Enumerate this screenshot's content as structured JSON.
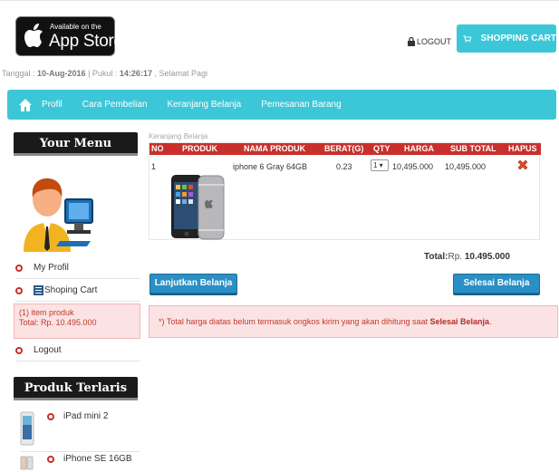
{
  "header": {
    "badge_small": "Available on the",
    "badge_large": "App Store",
    "logout": "LOGOUT",
    "cart_button": "SHOPPING CART",
    "icons": [
      "apple-icon",
      "lock-icon",
      "cart-icon"
    ]
  },
  "datebar": {
    "date_label": "Tanggal : ",
    "date_value": "10-Aug-2016",
    "time_label": " | Pukul : ",
    "time_value": "14:26:17",
    "greeting": " , Selamat Pagi"
  },
  "nav": {
    "home_icon": "home-icon",
    "items": [
      "Profil",
      "Cara Pembelian",
      "Keranjang Belanja",
      "Pemesanan Barang"
    ]
  },
  "sidebar": {
    "menu_title": "Your Menu",
    "items": [
      "My Profil",
      "Shoping Cart",
      "Logout"
    ],
    "cart_info_line1": "(1) item produk",
    "cart_info_line2": "Total: Rp. 10.495.000",
    "bestseller_title": "Produk Terlaris",
    "bestsellers": [
      "iPad mini 2",
      "iPhone SE 16GB"
    ]
  },
  "cart": {
    "caption": "Keranjang Belanja",
    "columns": [
      "NO",
      "PRODUK",
      "NAMA PRODUK",
      "BERAT(G)",
      "QTY",
      "HARGA",
      "SUB TOTAL",
      "HAPUS"
    ],
    "rows": [
      {
        "no": "1",
        "name": "iphone 6 Gray 64GB",
        "weight": "0.23",
        "qty": "1",
        "price": "10,495.000",
        "subtotal": "10,495.000"
      }
    ],
    "total_label": "Total:",
    "total_prefix": "Rp. ",
    "total_value": "10.495.000",
    "continue_button": "Lanjutkan Belanja",
    "finish_button": "Selesai Belanja",
    "notice_text": "*) Total harga diatas belum termasuk ongkos kirim yang akan dihitung saat ",
    "notice_bold": "Selesai Belanja",
    "notice_end": "."
  },
  "colors": {
    "accent": "#3cc7d8",
    "table_header": "#c9302c",
    "button": "#2a8fc4",
    "alert_bg": "#fbe3e4"
  }
}
